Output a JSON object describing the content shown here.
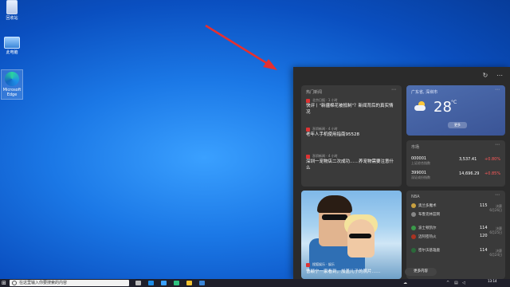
{
  "desktop": {
    "icons": [
      {
        "label": "回收站",
        "icon": "recycle-bin-icon"
      },
      {
        "label": "此电脑",
        "icon": "computer-icon"
      },
      {
        "label": "Microsoft Edge",
        "icon": "edge-icon"
      }
    ]
  },
  "panel": {
    "header": {
      "refresh_icon": "refresh-icon",
      "more_icon": "more-icon"
    },
    "news": {
      "title": "热门新闻",
      "items": [
        {
          "source": "北京日报 · 1 小时",
          "headline": "快评丨\"新疆棉花被抵制\"？新闻背后的真实情况"
        },
        {
          "source": "澎湃新闻 · 4 小时",
          "headline": "老年人手机使用指南95528"
        },
        {
          "source": "澎湃新闻 · 4 小时",
          "headline": "深圳一宠物店二次成功……养宠物需要注意什么"
        }
      ]
    },
    "weather": {
      "location": "广东省, 深圳市",
      "temperature": "28",
      "unit": "°C",
      "button": "更多",
      "icon": "partly-sunny-icon"
    },
    "stocks": {
      "title": "市场",
      "rows": [
        {
          "code": "000001",
          "name": "上证综合指数",
          "price": "3,537.41",
          "change": "+0.80%"
        },
        {
          "code": "399001",
          "name": "深证成份指数",
          "price": "14,696.29",
          "change": "+0.85%"
        }
      ]
    },
    "photo_news": {
      "source": "搜狐娱乐 · 娱乐",
      "headline": "曹颖宁一家看到，加盖儿子的照片……"
    },
    "sports": {
      "title": "NBA",
      "games": [
        {
          "team1": "奥兰多魔术",
          "score1": "115",
          "team2": "布鲁克林篮网",
          "score2": "",
          "info1": "决赛",
          "info2": "6月26日"
        },
        {
          "team1": "波士顿凯尔",
          "score1": "114",
          "team2": "迈阿密热火",
          "score2": "120",
          "info1": "决赛",
          "info2": "6月25日"
        },
        {
          "team1": "密尔沃基雄鹿",
          "score1": "114",
          "team2": "",
          "score2": "",
          "info1": "决赛",
          "info2": "6月24日"
        }
      ]
    },
    "more_button": "更多内容"
  },
  "taskbar": {
    "search_placeholder": "在这里输入你要搜索的内容",
    "clock_time": "13:14",
    "clock_date": "2021/6/28",
    "colors": {
      "accent": "#2b6fd4"
    }
  }
}
